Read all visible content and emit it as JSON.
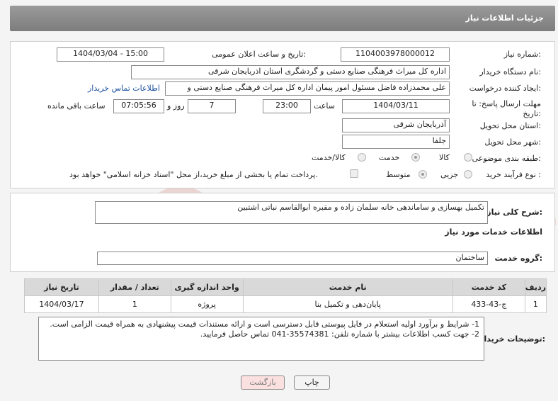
{
  "header": {
    "title": "جزئیات اطلاعات نیاز"
  },
  "fields": {
    "need_number_label": "شماره نیاز:",
    "need_number": "1104003978000012",
    "announce_label": "تاریخ و ساعت اعلان عمومی:",
    "announce_value": "1404/03/04 - 15:00",
    "buyer_org_label": "نام دستگاه خریدار:",
    "buyer_org": "اداره کل میراث فرهنگی  صنایع دستی و گردشگری استان اذربایجان شرقی",
    "requester_label": "ایجاد کننده درخواست:",
    "requester": "علی محمدزاده فاضل مسئول امور پیمان اداره کل میراث فرهنگی  صنایع دستی و",
    "buyer_contact_link": "اطلاعات تماس خریدار",
    "deadline_label_1": "مهلت ارسال پاسخ: تا",
    "deadline_label_2": "تاریخ:",
    "deadline_date": "1404/03/11",
    "time_label": "ساعت",
    "deadline_time": "23:00",
    "days_value": "7",
    "days_label": "روز و",
    "remaining_time": "07:05:56",
    "remaining_label": "ساعت باقی مانده",
    "province_label": "استان محل تحویل:",
    "province": "آذربایجان شرقی",
    "city_label": "شهر محل تحویل:",
    "city": "جلفا",
    "category_label": "طبقه بندی موضوعی:",
    "category_options": [
      "کالا",
      "خدمت",
      "کالا/خدمت"
    ],
    "category_selected": "خدمت",
    "process_label": "نوع فرآیند خرید :",
    "process_options": [
      "جزیی",
      "متوسط"
    ],
    "process_selected": "جزیی",
    "payment_note": "پرداخت تمام یا بخشی از مبلغ خرید،از محل \"اسناد خزانه اسلامی\" خواهد بود."
  },
  "summary": {
    "label": "شرح کلی نیاز:",
    "text": "تکمیل بهسازی و ساماندهی خانه سلمان زاده و مقبره ابوالقاسم نباتی اشتبین"
  },
  "services_section": {
    "title": "اطلاعات خدمات مورد نیاز",
    "group_label": "گروه خدمت:",
    "group_value": "ساختمان"
  },
  "table": {
    "headers": [
      "ردیف",
      "کد خدمت",
      "نام خدمت",
      "واحد اندازه گیری",
      "تعداد / مقدار",
      "تاریخ نیاز"
    ],
    "rows": [
      [
        "1",
        "ج-43-433",
        "پایان‌دهی و تکمیل بنا",
        "پروژه",
        "1",
        "1404/03/17"
      ]
    ]
  },
  "notes": {
    "label": "توضیحات خریدار:",
    "line1": "1- شرایط و برآورد اولیه استعلام در فایل پیوستی قابل دسترسی است و ارائه مستندات قیمت پیشنهادی به همراه قیمت الزامی است.",
    "line2": "2- جهت کسب اطلاعات بیشتر  با شماره تلفن: 35574381-041  تماس حاصل فرمایید."
  },
  "buttons": {
    "print": "چاپ",
    "back": "بازگشت"
  },
  "watermark": {
    "text": "AriaTender.net",
    "color": "#c0392b"
  }
}
